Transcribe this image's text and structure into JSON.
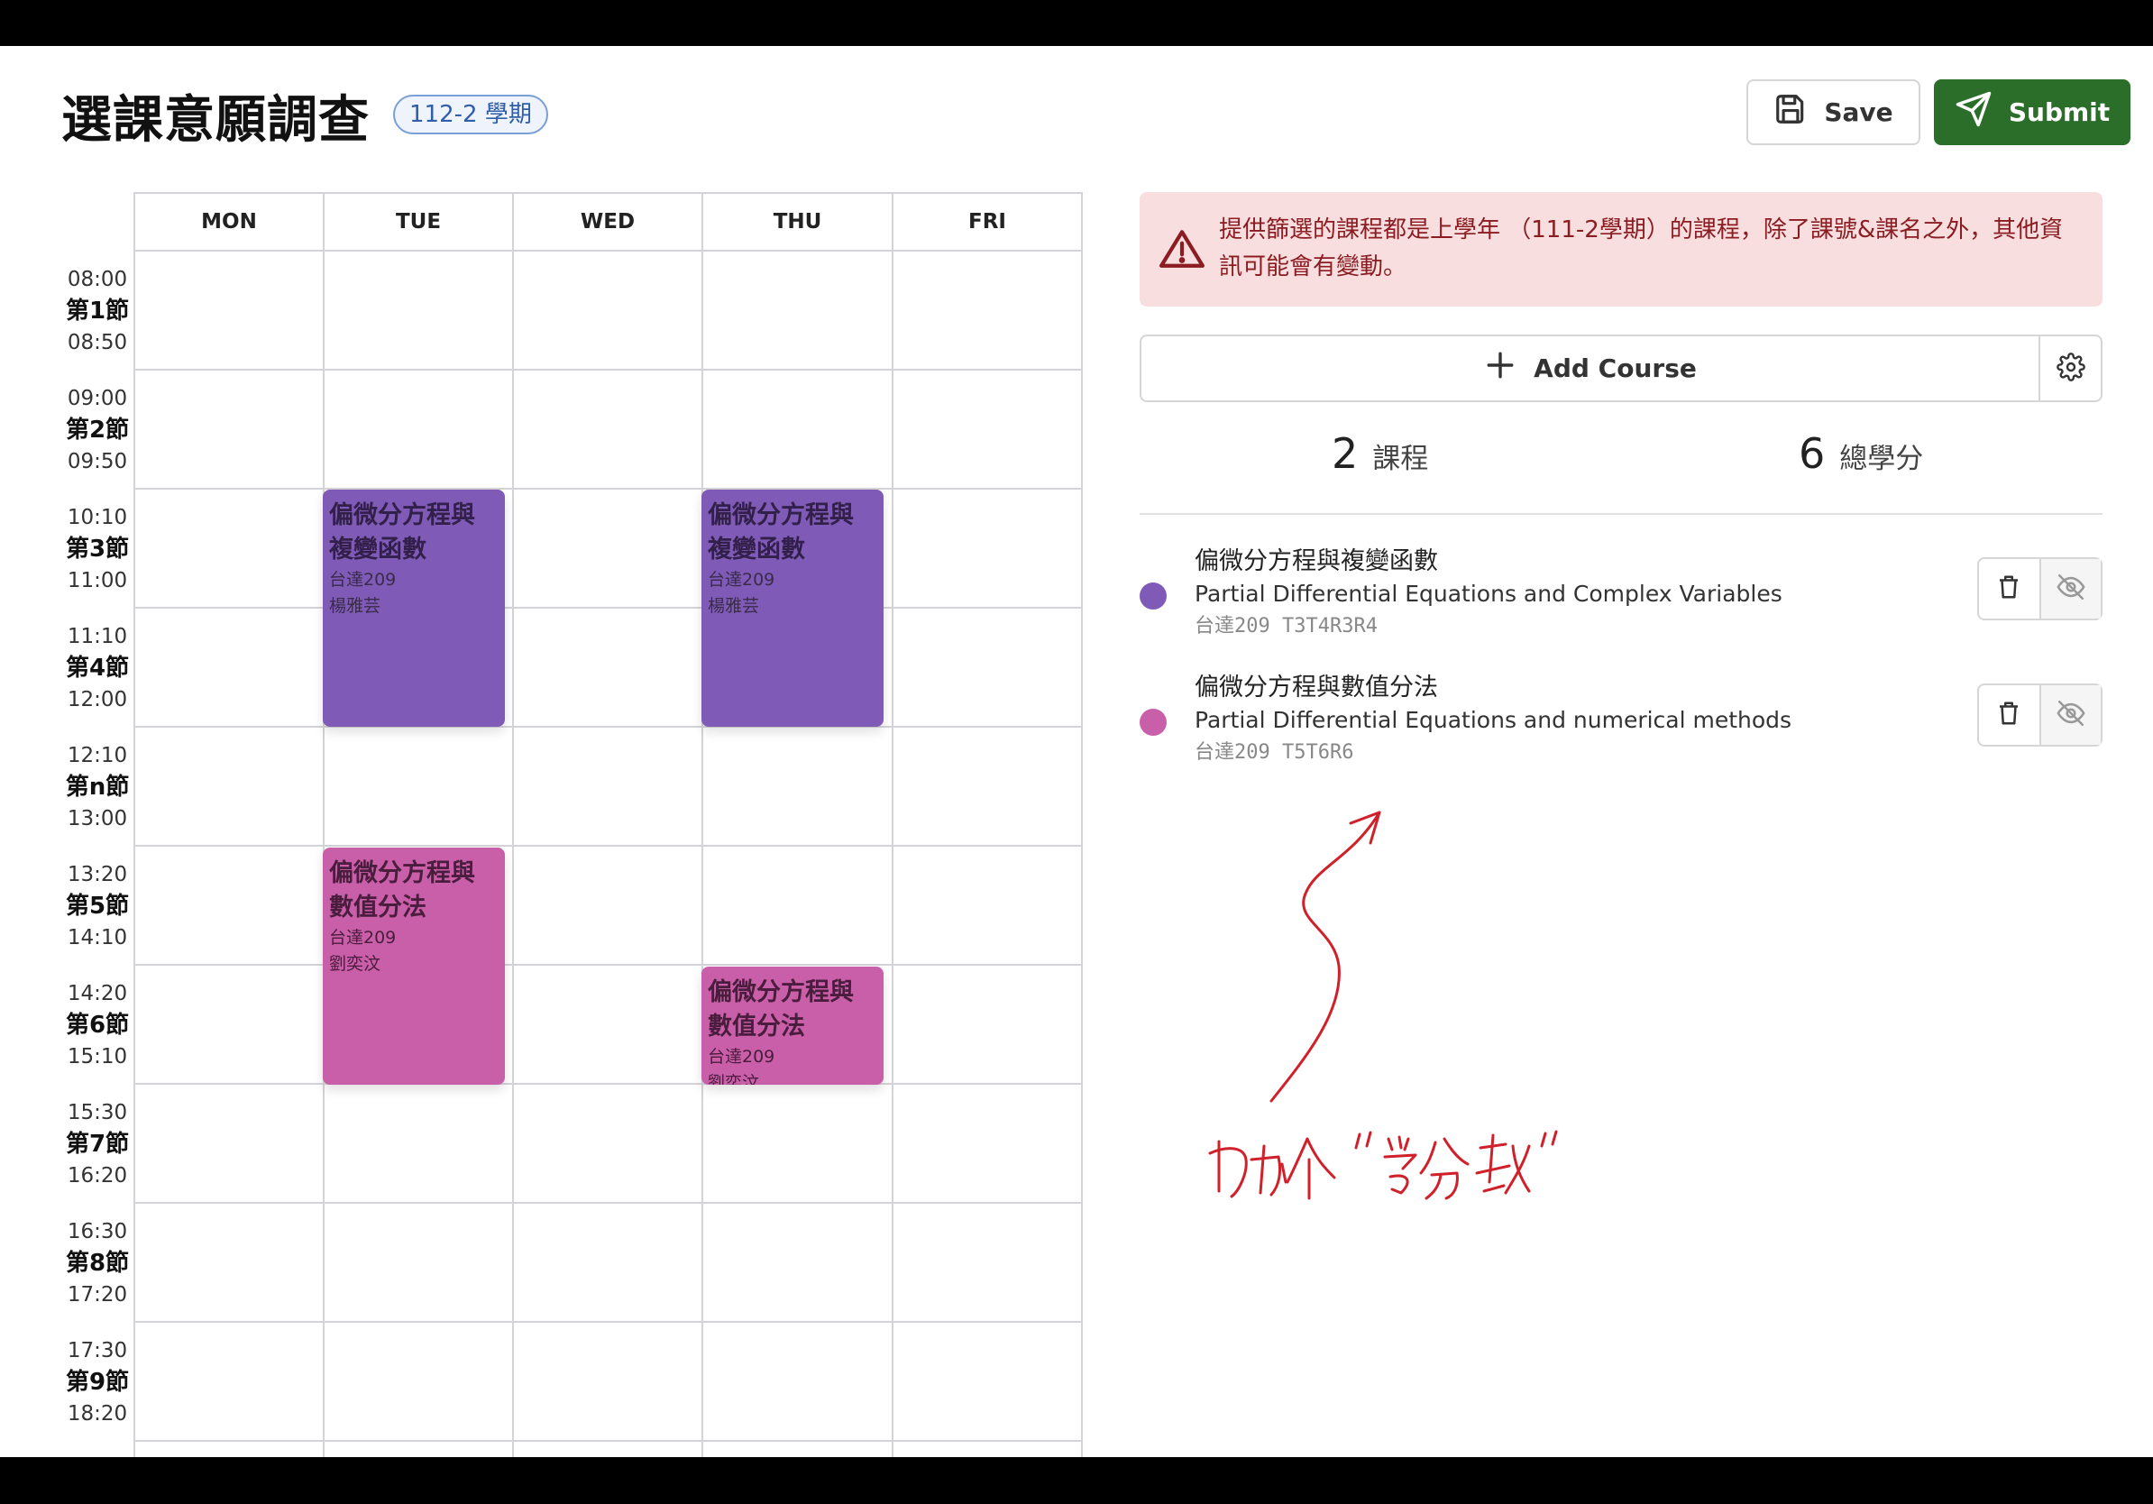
{
  "header": {
    "title": "選課意願調查",
    "term_badge": "112-2 學期",
    "save_label": "Save",
    "submit_label": "Submit"
  },
  "calendar": {
    "days": [
      "MON",
      "TUE",
      "WED",
      "THU",
      "FRI"
    ],
    "periods": [
      {
        "start": "08:00",
        "label": "第1節",
        "end": "08:50"
      },
      {
        "start": "09:00",
        "label": "第2節",
        "end": "09:50"
      },
      {
        "start": "10:10",
        "label": "第3節",
        "end": "11:00"
      },
      {
        "start": "11:10",
        "label": "第4節",
        "end": "12:00"
      },
      {
        "start": "12:10",
        "label": "第n節",
        "end": "13:00"
      },
      {
        "start": "13:20",
        "label": "第5節",
        "end": "14:10"
      },
      {
        "start": "14:20",
        "label": "第6節",
        "end": "15:10"
      },
      {
        "start": "15:30",
        "label": "第7節",
        "end": "16:20"
      },
      {
        "start": "16:30",
        "label": "第8節",
        "end": "17:20"
      },
      {
        "start": "17:30",
        "label": "第9節",
        "end": "18:20"
      }
    ],
    "events": [
      {
        "name": "偏微分方程與複變函數",
        "room": "台達209",
        "teacher": "楊雅芸"
      },
      {
        "name": "偏微分方程與複變函數",
        "room": "台達209",
        "teacher": "楊雅芸"
      },
      {
        "name": "偏微分方程與數值分法",
        "room": "台達209",
        "teacher": "劉奕汶"
      },
      {
        "name": "偏微分方程與數值分法",
        "room": "台達209",
        "teacher": "劉奕汶"
      }
    ]
  },
  "alert": {
    "text": "提供篩選的課程都是上學年 （111-2學期）的課程，除了課號&課名之外，其他資訊可能會有變動。"
  },
  "add_course": {
    "label": "Add Course"
  },
  "stats": {
    "course_count": "2",
    "course_count_label": "課程",
    "total_credits": "6",
    "total_credits_label": "總學分"
  },
  "courses": [
    {
      "name_zh": "偏微分方程與複變函數",
      "name_en": "Partial Differential Equations and Complex Variables",
      "meta": "台達209  T3T4R3R4",
      "color": "#7f5ab6"
    },
    {
      "name_zh": "偏微分方程與數值分法",
      "name_en": "Partial Differential Equations and numerical methods",
      "meta": "台達209  T5T6R6",
      "color": "#c95fa8"
    }
  ],
  "annotation": {
    "handwritten_note": "可加个“学分数”",
    "color": "#d0202a"
  },
  "colors": {
    "submit": "#2a6e2a",
    "course_purple": "#7f5ab6",
    "course_pink": "#c95fa8",
    "alert_bg": "#f8dedf",
    "alert_text": "#8b1d22"
  }
}
